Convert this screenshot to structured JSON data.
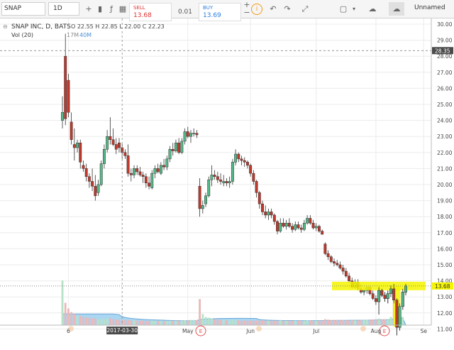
{
  "toolbar": {
    "symbol": "SNAP",
    "interval": "1D",
    "sell_label": "SELL",
    "sell_price": "13.68",
    "spread": "0.01",
    "buy_label": "BUY",
    "buy_price": "13.69",
    "layout_name": "Unnamed",
    "plus": "+",
    "minus": "−",
    "info": "i"
  },
  "legend": {
    "title": "SNAP INC, D, BATS",
    "ohlc": "O 22.55 H 22.85 L 22.00 C 22.23",
    "vol_label": "Vol (20)",
    "vol_v1": "17M",
    "vol_v2": "40M"
  },
  "price_axis": {
    "ticks": [
      "30.00",
      "29.00",
      "28.00",
      "27.00",
      "26.00",
      "25.00",
      "24.00",
      "23.00",
      "22.00",
      "21.00",
      "20.00",
      "19.00",
      "18.00",
      "17.00",
      "16.00",
      "15.00",
      "14.00",
      "13.00",
      "12.00",
      "11.00"
    ],
    "current": "13.68",
    "crosshair": "28.35"
  },
  "time_axis": {
    "labels": [
      "6",
      "May",
      "Jun",
      "Jul",
      "Aug",
      "Se"
    ],
    "crosshair": "2017-03-30"
  },
  "colors": {
    "up": "#53b987",
    "down": "#c0392b",
    "highlight": "#f5f500",
    "crosshair_tag": "#4a4a4a",
    "volume_area": "#8ec8ee",
    "marker": "#e05050"
  },
  "chart_data": {
    "type": "candlestick",
    "y_range": [
      10.5,
      30.3
    ],
    "dates": [
      "Mar 2",
      "Mar 3",
      "Mar 6",
      "Mar 7",
      "Mar 8",
      "Mar 9",
      "Mar 10",
      "Mar 13",
      "Mar 14",
      "Mar 15",
      "Mar 16",
      "Mar 17",
      "Mar 20",
      "Mar 21",
      "Mar 22",
      "Mar 23",
      "Mar 24",
      "Mar 27",
      "Mar 28",
      "Mar 29",
      "Mar 30",
      "Mar 31",
      "Apr 3",
      "Apr 4",
      "Apr 5",
      "Apr 6",
      "Apr 7",
      "Apr 10",
      "Apr 11",
      "Apr 12",
      "Apr 13",
      "Apr 17",
      "Apr 18",
      "Apr 19",
      "Apr 20",
      "Apr 21",
      "Apr 24",
      "Apr 25",
      "Apr 26",
      "Apr 27",
      "Apr 28",
      "May 1",
      "May 2",
      "May 3",
      "May 4",
      "May 5",
      "May 8",
      "May 9",
      "May 10",
      "May 11",
      "May 12",
      "May 15",
      "May 16",
      "May 17",
      "May 18",
      "May 19",
      "May 22",
      "May 23",
      "May 24",
      "May 25",
      "May 26",
      "May 30",
      "May 31",
      "Jun 1",
      "Jun 2",
      "Jun 5",
      "Jun 6",
      "Jun 7",
      "Jun 8",
      "Jun 9",
      "Jun 12",
      "Jun 13",
      "Jun 14",
      "Jun 15",
      "Jun 16",
      "Jun 19",
      "Jun 20",
      "Jun 21",
      "Jun 22",
      "Jun 23",
      "Jun 26",
      "Jun 27",
      "Jun 28",
      "Jun 29",
      "Jun 30",
      "Jul 3",
      "Jul 5",
      "Jul 6",
      "Jul 7",
      "Jul 10",
      "Jul 11",
      "Jul 12",
      "Jul 13",
      "Jul 14",
      "Jul 17",
      "Jul 18",
      "Jul 19",
      "Jul 20",
      "Jul 21",
      "Jul 24",
      "Jul 25",
      "Jul 26",
      "Jul 27",
      "Jul 28",
      "Jul 31",
      "Aug 1",
      "Aug 2",
      "Aug 3",
      "Aug 4",
      "Aug 7",
      "Aug 8",
      "Aug 9",
      "Aug 10",
      "Aug 11",
      "Aug 14",
      "Aug 15"
    ],
    "ohlc": [
      [
        24,
        25.5,
        23.5,
        24.5
      ],
      [
        28,
        29.4,
        23.7,
        24.1
      ],
      [
        26.5,
        26.9,
        24.2,
        24.5
      ],
      [
        23.9,
        24.5,
        22.5,
        22.8
      ],
      [
        22.5,
        23.5,
        21.5,
        22.3
      ],
      [
        22.3,
        22.8,
        22,
        22.6
      ],
      [
        22.6,
        22.8,
        21,
        21.4
      ],
      [
        21.2,
        21.5,
        20.8,
        21
      ],
      [
        21,
        21.3,
        20.2,
        20.5
      ],
      [
        20.5,
        20.7,
        19.8,
        20.2
      ],
      [
        20.2,
        21,
        19.6,
        19.9
      ],
      [
        19.9,
        20.6,
        19,
        19.3
      ],
      [
        19.5,
        20.3,
        19.3,
        20
      ],
      [
        20,
        21.5,
        19.9,
        21.3
      ],
      [
        21.3,
        22.5,
        21,
        22.2
      ],
      [
        22.2,
        23.4,
        22,
        23
      ],
      [
        23,
        24.2,
        22.5,
        22.8
      ],
      [
        22.8,
        23.5,
        22.4,
        22.5
      ],
      [
        22.5,
        22.9,
        21.9,
        22.2
      ],
      [
        22.6,
        22.9,
        22,
        22.3
      ],
      [
        22.3,
        22.6,
        21.6,
        22
      ],
      [
        22,
        22.2,
        21.6,
        21.8
      ],
      [
        21.8,
        22.5,
        20.5,
        20.7
      ],
      [
        20.7,
        21,
        20.2,
        20.6
      ],
      [
        20.6,
        21.2,
        20.4,
        21
      ],
      [
        21,
        21.2,
        20.6,
        20.8
      ],
      [
        20.8,
        21.1,
        20.5,
        20.6
      ],
      [
        20.6,
        20.8,
        20.1,
        20.5
      ],
      [
        20.5,
        20.7,
        19.8,
        20.1
      ],
      [
        20.1,
        20.5,
        19.7,
        19.9
      ],
      [
        19.8,
        20.9,
        19.7,
        20.7
      ],
      [
        20.7,
        21.2,
        20.4,
        21
      ],
      [
        21,
        21.3,
        20.7,
        20.8
      ],
      [
        20.7,
        21.4,
        20.6,
        21.2
      ],
      [
        21.2,
        21.6,
        20.9,
        21.1
      ],
      [
        21.1,
        21.8,
        20.9,
        21.6
      ],
      [
        21.6,
        22.4,
        21.4,
        22.2
      ],
      [
        22.2,
        22.6,
        21.8,
        22.1
      ],
      [
        22.1,
        22.8,
        22,
        22.6
      ],
      [
        22.6,
        22.9,
        21.9,
        22
      ],
      [
        22,
        22.9,
        21.9,
        22.7
      ],
      [
        22.7,
        23.5,
        22.5,
        23.3
      ],
      [
        23.3,
        23.6,
        22.9,
        23
      ],
      [
        23,
        23.4,
        22.6,
        23.2
      ],
      [
        23.2,
        23.5,
        23,
        23.2
      ],
      [
        23.2,
        23.4,
        22.9,
        23.1
      ],
      [
        19.9,
        20.4,
        18,
        18.5
      ],
      [
        18.5,
        19,
        18.2,
        18.7
      ],
      [
        18.8,
        19.5,
        18.6,
        19.3
      ],
      [
        19.3,
        20.5,
        19.2,
        20.3
      ],
      [
        20.3,
        21.2,
        19.9,
        20.6
      ],
      [
        20.6,
        20.9,
        20.3,
        20.5
      ],
      [
        20.5,
        20.8,
        20.1,
        20.3
      ],
      [
        20.3,
        20.7,
        20,
        20.2
      ],
      [
        20.1,
        20.6,
        19.9,
        20.2
      ],
      [
        20.2,
        20.4,
        19.9,
        20.1
      ],
      [
        20.1,
        20.5,
        19.8,
        20.2
      ],
      [
        20.2,
        21.6,
        20,
        21.4
      ],
      [
        21.4,
        22.2,
        21.2,
        21.9
      ],
      [
        21.9,
        22,
        21.4,
        21.6
      ],
      [
        21.6,
        21.8,
        21.2,
        21.5
      ],
      [
        21.5,
        21.7,
        21.1,
        21.4
      ],
      [
        21.4,
        21.5,
        21,
        21.2
      ],
      [
        21.2,
        21.3,
        20.5,
        20.7
      ],
      [
        20.7,
        20.9,
        20,
        20.2
      ],
      [
        20.2,
        20.3,
        19.2,
        19.5
      ],
      [
        19.5,
        19.6,
        18.5,
        18.8
      ],
      [
        18.8,
        19,
        18.1,
        18.3
      ],
      [
        18.3,
        18.7,
        17.9,
        18.1
      ],
      [
        18.1,
        18.5,
        17.8,
        18.3
      ],
      [
        18.3,
        18.5,
        17.9,
        18.1
      ],
      [
        18.1,
        18.2,
        17.5,
        17.7
      ],
      [
        17.7,
        17.8,
        16.9,
        17.1
      ],
      [
        17.1,
        17.9,
        17,
        17.6
      ],
      [
        17.6,
        17.9,
        17.3,
        17.4
      ],
      [
        17.4,
        17.8,
        17.2,
        17.6
      ],
      [
        17.6,
        17.9,
        17.3,
        17.4
      ],
      [
        17.4,
        17.6,
        17,
        17.2
      ],
      [
        17.2,
        17.7,
        17.1,
        17.5
      ],
      [
        17.5,
        17.7,
        17.2,
        17.3
      ],
      [
        17.3,
        17.5,
        17,
        17.2
      ],
      [
        17.2,
        17.8,
        17.1,
        17.6
      ],
      [
        17.6,
        18.1,
        17.5,
        17.9
      ],
      [
        17.9,
        18.1,
        17.5,
        17.6
      ],
      [
        17.6,
        17.8,
        17.2,
        17.3
      ],
      [
        17.3,
        17.6,
        17.1,
        17.4
      ],
      [
        17.4,
        17.5,
        17,
        17.1
      ],
      [
        17.1,
        17.2,
        16.9,
        16.9
      ],
      [
        16.3,
        16.4,
        15.6,
        15.7
      ],
      [
        15.7,
        15.9,
        15.3,
        15.5
      ],
      [
        15.5,
        15.6,
        15.1,
        15.2
      ],
      [
        15.2,
        15.4,
        14.9,
        15.1
      ],
      [
        15.1,
        15.3,
        14.9,
        15
      ],
      [
        15,
        15.2,
        14.7,
        14.8
      ],
      [
        14.8,
        15,
        14.4,
        14.6
      ],
      [
        14.6,
        14.8,
        14.2,
        14.3
      ],
      [
        14.3,
        14.5,
        13.9,
        14
      ],
      [
        14,
        14.2,
        13.5,
        13.6
      ],
      [
        13.6,
        14.1,
        13.5,
        13.9
      ],
      [
        13.9,
        14.1,
        13.4,
        13.5
      ],
      [
        13.5,
        13.8,
        13.2,
        13.3
      ],
      [
        13.3,
        13.6,
        13.1,
        13.4
      ],
      [
        13.4,
        13.7,
        13.2,
        13.6
      ],
      [
        13.6,
        13.7,
        13.1,
        13.2
      ],
      [
        13.2,
        13.4,
        12.8,
        12.9
      ],
      [
        12.9,
        13.1,
        12.5,
        12.7
      ],
      [
        12.7,
        13.6,
        11.9,
        13.4
      ],
      [
        13.4,
        13.5,
        13,
        13.1
      ],
      [
        13.1,
        13.3,
        12.7,
        12.9
      ],
      [
        12.9,
        13.4,
        12.6,
        13.2
      ],
      [
        13.2,
        13.7,
        13,
        13.5
      ],
      [
        13.5,
        13.8,
        12.6,
        12.8
      ],
      [
        12.8,
        12.9,
        10.6,
        11.1
      ],
      [
        11.1,
        12.6,
        10.9,
        12.4
      ],
      [
        12.4,
        13.5,
        12.2,
        13.3
      ],
      [
        13.3,
        13.8,
        13.1,
        13.68
      ]
    ],
    "volume_millions": [
      120,
      60,
      45,
      35,
      30,
      25,
      25,
      22,
      20,
      20,
      18,
      18,
      16,
      16,
      16,
      18,
      18,
      16,
      15,
      15,
      14,
      14,
      14,
      13,
      13,
      12,
      12,
      12,
      11,
      11,
      12,
      12,
      11,
      11,
      11,
      11,
      12,
      12,
      12,
      12,
      12,
      13,
      13,
      14,
      14,
      14,
      70,
      30,
      22,
      20,
      18,
      16,
      15,
      14,
      14,
      13,
      13,
      14,
      14,
      13,
      12,
      12,
      12,
      12,
      12,
      12,
      13,
      13,
      12,
      12,
      12,
      12,
      12,
      13,
      12,
      12,
      12,
      12,
      12,
      12,
      12,
      12,
      13,
      13,
      12,
      12,
      12,
      12,
      16,
      15,
      14,
      14,
      14,
      13,
      14,
      13,
      13,
      14,
      13,
      13,
      14,
      14,
      14,
      15,
      15,
      16,
      18,
      16,
      16,
      17,
      22,
      60,
      35,
      30,
      22
    ]
  }
}
